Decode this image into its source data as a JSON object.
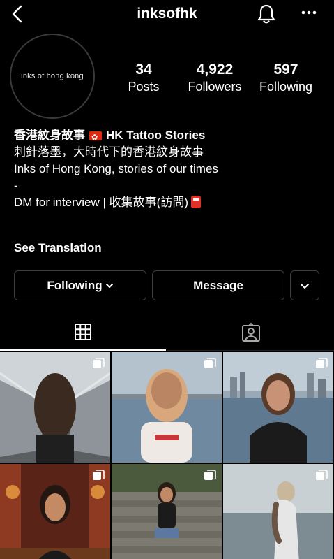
{
  "header": {
    "username": "inksofhk"
  },
  "profile": {
    "avatar_text": "inks of hong kong",
    "stats": [
      {
        "value": "34",
        "label": "Posts"
      },
      {
        "value": "4,922",
        "label": "Followers"
      },
      {
        "value": "597",
        "label": "Following"
      }
    ],
    "bio": {
      "name_zh": "香港紋身故事",
      "name_en": "HK Tattoo Stories",
      "line1": "刺針落墨，大時代下的香港紋身故事",
      "line2": "Inks of Hong Kong, stories of our times",
      "line3": "-",
      "line4": "DM for interview | 收集故事(訪問)"
    },
    "see_translation": "See Translation"
  },
  "actions": {
    "following": "Following",
    "message": "Message"
  },
  "colors": {
    "background": "#000000",
    "text": "#ffffff",
    "border": "#3c3c3c"
  },
  "grid_posts": [
    {
      "desc": "woman from behind on bridge"
    },
    {
      "desc": "woman smiling at harbour"
    },
    {
      "desc": "woman at waterfront skyline"
    },
    {
      "desc": "woman praying at temple"
    },
    {
      "desc": "woman sitting on steps"
    },
    {
      "desc": "woman by the sea"
    }
  ]
}
